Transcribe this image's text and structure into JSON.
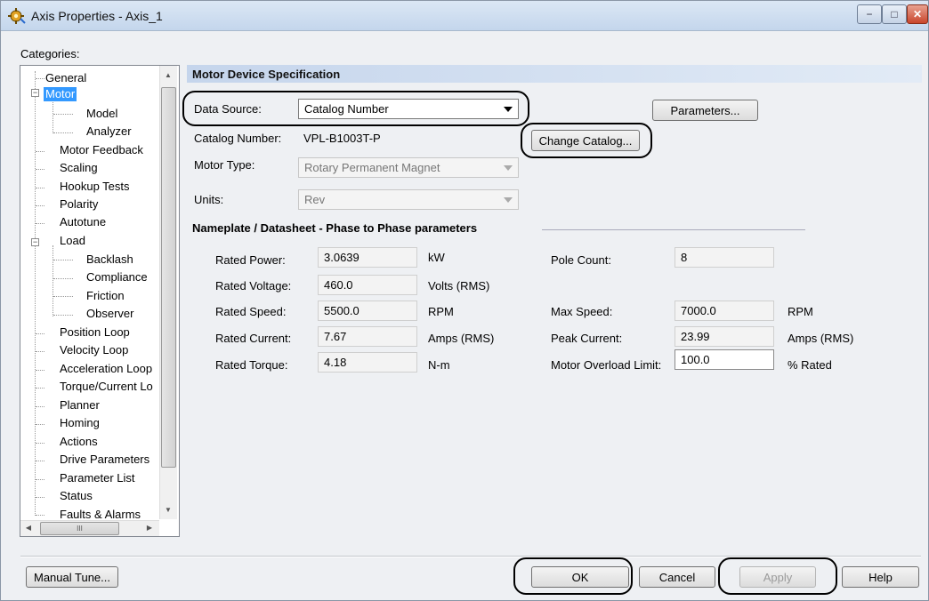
{
  "window": {
    "title": "Axis Properties - Axis_1",
    "controls": {
      "minimize": "−",
      "maximize": "□",
      "close": "✕"
    }
  },
  "categories": {
    "label": "Categories:",
    "items": [
      {
        "label": "General"
      },
      {
        "label": "Motor",
        "selected": true
      },
      {
        "label": "Model"
      },
      {
        "label": "Analyzer"
      },
      {
        "label": "Motor Feedback"
      },
      {
        "label": "Scaling"
      },
      {
        "label": "Hookup Tests"
      },
      {
        "label": "Polarity"
      },
      {
        "label": "Autotune"
      },
      {
        "label": "Load"
      },
      {
        "label": "Backlash"
      },
      {
        "label": "Compliance"
      },
      {
        "label": "Friction"
      },
      {
        "label": "Observer"
      },
      {
        "label": "Position Loop"
      },
      {
        "label": "Velocity Loop"
      },
      {
        "label": "Acceleration Loop"
      },
      {
        "label": "Torque/Current Lo"
      },
      {
        "label": "Planner"
      },
      {
        "label": "Homing"
      },
      {
        "label": "Actions"
      },
      {
        "label": "Drive Parameters"
      },
      {
        "label": "Parameter List"
      },
      {
        "label": "Status"
      },
      {
        "label": "Faults & Alarms"
      }
    ],
    "hscroll_grip": "III"
  },
  "motor_spec": {
    "header": "Motor Device Specification",
    "data_source": {
      "label": "Data Source:",
      "value": "Catalog Number"
    },
    "parameters_button": "Parameters...",
    "catalog_number": {
      "label": "Catalog Number:",
      "value": "VPL-B1003T-P"
    },
    "change_catalog_button": "Change Catalog...",
    "motor_type": {
      "label": "Motor Type:",
      "value": "Rotary Permanent Magnet"
    },
    "units": {
      "label": "Units:",
      "value": "Rev"
    }
  },
  "nameplate": {
    "title": "Nameplate / Datasheet - Phase to Phase parameters",
    "rated_power": {
      "label": "Rated Power:",
      "value": "3.0639",
      "unit": "kW"
    },
    "rated_voltage": {
      "label": "Rated Voltage:",
      "value": "460.0",
      "unit": "Volts (RMS)"
    },
    "rated_speed": {
      "label": "Rated Speed:",
      "value": "5500.0",
      "unit": "RPM"
    },
    "rated_current": {
      "label": "Rated Current:",
      "value": "7.67",
      "unit": "Amps (RMS)"
    },
    "rated_torque": {
      "label": "Rated Torque:",
      "value": "4.18",
      "unit": "N-m"
    },
    "pole_count": {
      "label": "Pole Count:",
      "value": "8"
    },
    "max_speed": {
      "label": "Max Speed:",
      "value": "7000.0",
      "unit": "RPM"
    },
    "peak_current": {
      "label": "Peak Current:",
      "value": "23.99",
      "unit": "Amps (RMS)"
    },
    "overload_limit": {
      "label": "Motor Overload Limit:",
      "value": "100.0",
      "unit": "% Rated"
    }
  },
  "footer": {
    "manual_tune": "Manual Tune...",
    "ok": "OK",
    "cancel": "Cancel",
    "apply": "Apply",
    "help": "Help"
  }
}
